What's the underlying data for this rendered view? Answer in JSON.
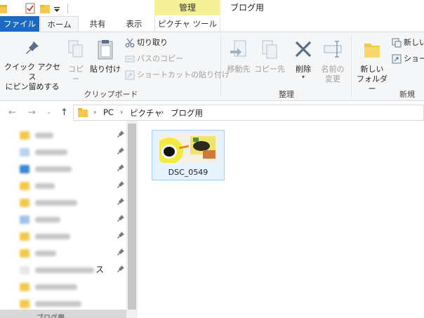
{
  "window": {
    "title": "ブログ用",
    "context_group": "管理"
  },
  "tabs": {
    "file": "ファイル",
    "home": "ホーム",
    "share": "共有",
    "view": "表示",
    "picture_tools": "ピクチャ ツール"
  },
  "ribbon": {
    "clipboard": {
      "pin_quick_access_line1": "クイック アクセス",
      "pin_quick_access_line2": "にピン留めする",
      "copy": "コピー",
      "paste": "貼り付け",
      "cut": "切り取り",
      "copy_path": "パスのコピー",
      "paste_shortcut": "ショートカットの貼り付け",
      "group_label": "クリップボード"
    },
    "organize": {
      "move_to_line1": "移動先",
      "copy_to_line1": "コピー先",
      "delete": "削除",
      "rename_line1": "名前の",
      "rename_line2": "変更",
      "group_label": "整理"
    },
    "new": {
      "new_folder_line1": "新しい",
      "new_folder_line2": "フォルダー",
      "new_item": "新しい",
      "shortcut": "ショー",
      "group_label": "新規"
    }
  },
  "address": {
    "crumbs": [
      "PC",
      "ピクチャ",
      "ブログ用"
    ]
  },
  "nav": {
    "partial_label": "ス",
    "selected_label": "ブログ用"
  },
  "content": {
    "files": [
      {
        "name": "DSC_0549"
      }
    ]
  },
  "colors": {
    "file_tab": "#1a6bbf",
    "context_tab": "#f4f196",
    "selection": "#e6f2fe"
  }
}
